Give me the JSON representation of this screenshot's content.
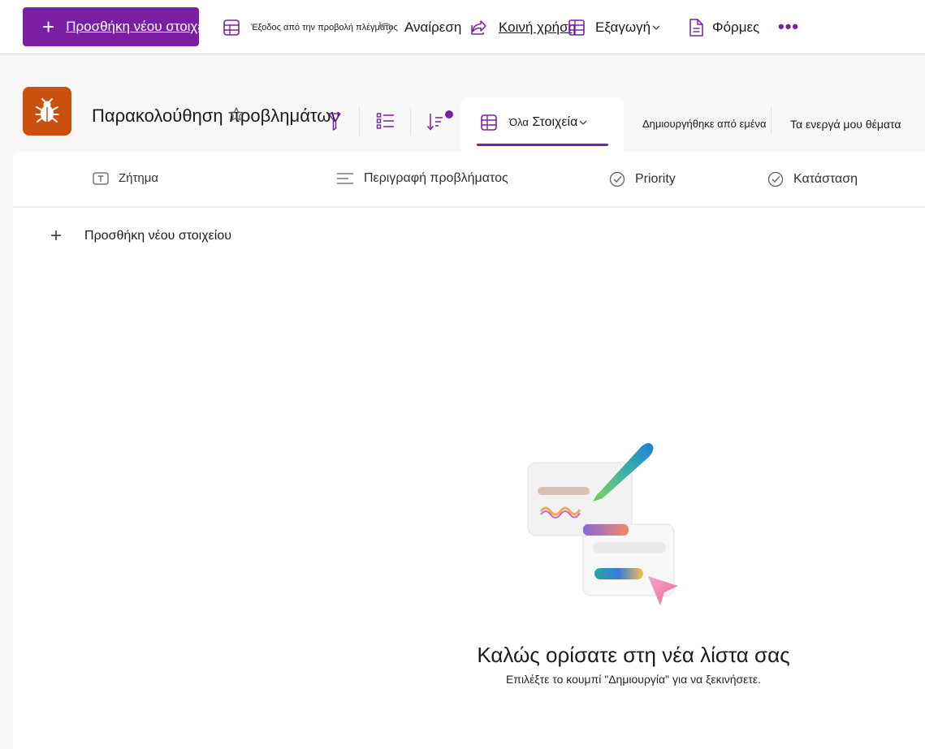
{
  "command_bar": {
    "new_item_label": "Προσθήκη νέου στοιχείου",
    "exit_grid_label": "Έξοδος από την προβολή πλέγματος",
    "undo_label": "Αναίρεση",
    "share_label": "Κοινή χρήση",
    "export_label": "Εξαγωγή",
    "forms_label": "Φόρμες",
    "more_label": "•••"
  },
  "header": {
    "list_title": "Παρακολούθηση προβλημάτων",
    "app_icon": "bug-icon"
  },
  "views": {
    "active_prefix": "Όλα",
    "active_label": "Στοιχεία",
    "others": [
      "Δημιουργήθηκε από εμένα",
      "Τα ενεργά μου θέματα"
    ]
  },
  "columns": [
    {
      "label": "Ζήτημα",
      "icon": "text-field-icon"
    },
    {
      "label": "Περιγραφή προβλήματος",
      "icon": "multiline-text-icon"
    },
    {
      "label": "Priority",
      "icon": "choice-check-icon"
    },
    {
      "label": "Κατάσταση",
      "icon": "choice-check-icon"
    }
  ],
  "add_row_label": "Προσθήκη νέου στοιχείου",
  "empty_state": {
    "title": "Καλώς ορίσατε στη νέα λίστα σας",
    "subtitle": "Επιλέξτε το κουμπί \"Δημιουργία\" για να ξεκινήσετε."
  },
  "colors": {
    "accent": "#7b1fa2",
    "app_icon_bg": "#ca5010"
  }
}
